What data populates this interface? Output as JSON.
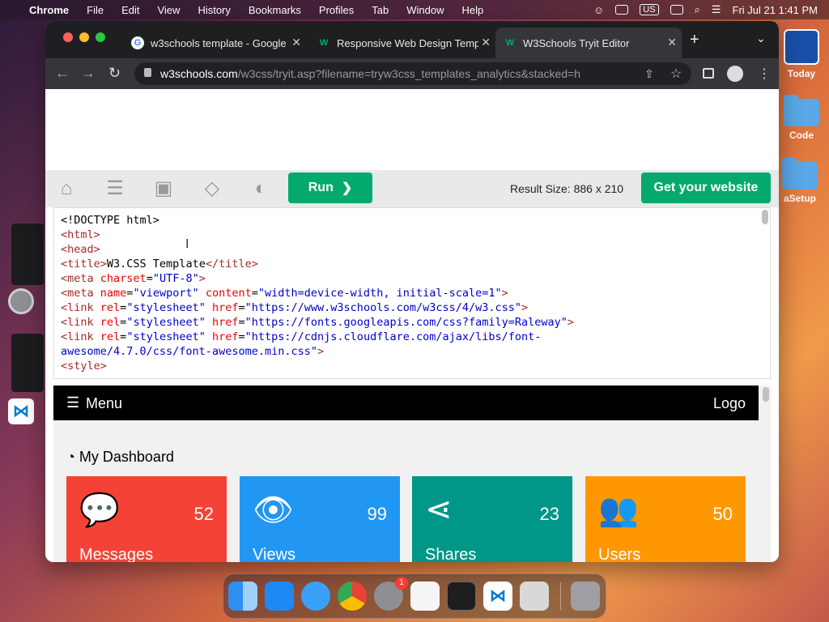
{
  "menubar": {
    "app": "Chrome",
    "items": [
      "File",
      "Edit",
      "View",
      "History",
      "Bookmarks",
      "Profiles",
      "Tab",
      "Window",
      "Help"
    ],
    "input_source": "US",
    "datetime": "Fri Jul 21  1:41 PM"
  },
  "desktop": {
    "icons": [
      {
        "label": "Today",
        "icon": "app-widget-icon"
      },
      {
        "label": "Code",
        "icon": "folder-icon"
      },
      {
        "label": "aSetup",
        "icon": "folder-icon"
      }
    ]
  },
  "browser": {
    "tabs": [
      {
        "title": "w3schools template - Google",
        "favicon": "google-icon",
        "active": false
      },
      {
        "title": "Responsive Web Design Temp",
        "favicon": "w3schools-icon",
        "active": false
      },
      {
        "title": "W3Schools Tryit Editor",
        "favicon": "w3schools-icon",
        "active": true
      }
    ],
    "url_host": "w3schools.com",
    "url_path": "/w3css/tryit.asp?filename=tryw3css_templates_analytics&stacked=h"
  },
  "toolbar": {
    "run_label": "Run",
    "run_arrow": "❯",
    "result_size": "Result Size: 886 x 210",
    "get_website_label": "Get your website"
  },
  "editor": {
    "lines": [
      [
        [
          "c",
          "<!DOCTYPE html>"
        ]
      ],
      [
        [
          "t",
          "<html>"
        ]
      ],
      [
        [
          "t",
          "<head>"
        ]
      ],
      [
        [
          "t",
          "<title>"
        ],
        [
          "c",
          "W3.CSS Template"
        ],
        [
          "t",
          "</title>"
        ]
      ],
      [
        [
          "t",
          "<meta "
        ],
        [
          "a",
          "charset"
        ],
        [
          "c",
          "="
        ],
        [
          "v",
          "\"UTF-8\""
        ],
        [
          "t",
          ">"
        ]
      ],
      [
        [
          "t",
          "<meta "
        ],
        [
          "a",
          "name"
        ],
        [
          "c",
          "="
        ],
        [
          "v",
          "\"viewport\" "
        ],
        [
          "a",
          "content"
        ],
        [
          "c",
          "="
        ],
        [
          "v",
          "\"width=device-width, initial-scale=1\""
        ],
        [
          "t",
          ">"
        ]
      ],
      [
        [
          "t",
          "<link "
        ],
        [
          "a",
          "rel"
        ],
        [
          "c",
          "="
        ],
        [
          "v",
          "\"stylesheet\" "
        ],
        [
          "a",
          "href"
        ],
        [
          "c",
          "="
        ],
        [
          "v",
          "\"https://www.w3schools.com/w3css/4/w3.css\""
        ],
        [
          "t",
          ">"
        ]
      ],
      [
        [
          "t",
          "<link "
        ],
        [
          "a",
          "rel"
        ],
        [
          "c",
          "="
        ],
        [
          "v",
          "\"stylesheet\" "
        ],
        [
          "a",
          "href"
        ],
        [
          "c",
          "="
        ],
        [
          "v",
          "\"https://fonts.googleapis.com/css?family=Raleway\""
        ],
        [
          "t",
          ">"
        ]
      ],
      [
        [
          "t",
          "<link "
        ],
        [
          "a",
          "rel"
        ],
        [
          "c",
          "="
        ],
        [
          "v",
          "\"stylesheet\" "
        ],
        [
          "a",
          "href"
        ],
        [
          "c",
          "="
        ],
        [
          "v",
          "\"https://cdnjs.cloudflare.com/ajax/libs/font-"
        ]
      ],
      [
        [
          "v",
          "awesome/4.7.0/css/font-awesome.min.css\""
        ],
        [
          "t",
          ">"
        ]
      ],
      [
        [
          "t",
          "<style>"
        ]
      ]
    ]
  },
  "result": {
    "menu_label": "Menu",
    "logo_label": "Logo",
    "dashboard_title": "My Dashboard",
    "cards": [
      {
        "label": "Messages",
        "count": "52",
        "color": "#f44336",
        "icon": "comment-icon"
      },
      {
        "label": "Views",
        "count": "99",
        "color": "#2196f3",
        "icon": "eye-icon"
      },
      {
        "label": "Shares",
        "count": "23",
        "color": "#009688",
        "icon": "share-icon"
      },
      {
        "label": "Users",
        "count": "50",
        "color": "#ff9800",
        "icon": "users-icon"
      }
    ]
  },
  "dock": {
    "apps": [
      "finder-icon",
      "app-store-icon",
      "safari-icon",
      "chrome-icon",
      "system-settings-icon",
      "textedit-icon",
      "terminal-icon",
      "vscode-icon",
      "launchpad-icon",
      "trash-icon"
    ],
    "settings_badge": "1"
  }
}
